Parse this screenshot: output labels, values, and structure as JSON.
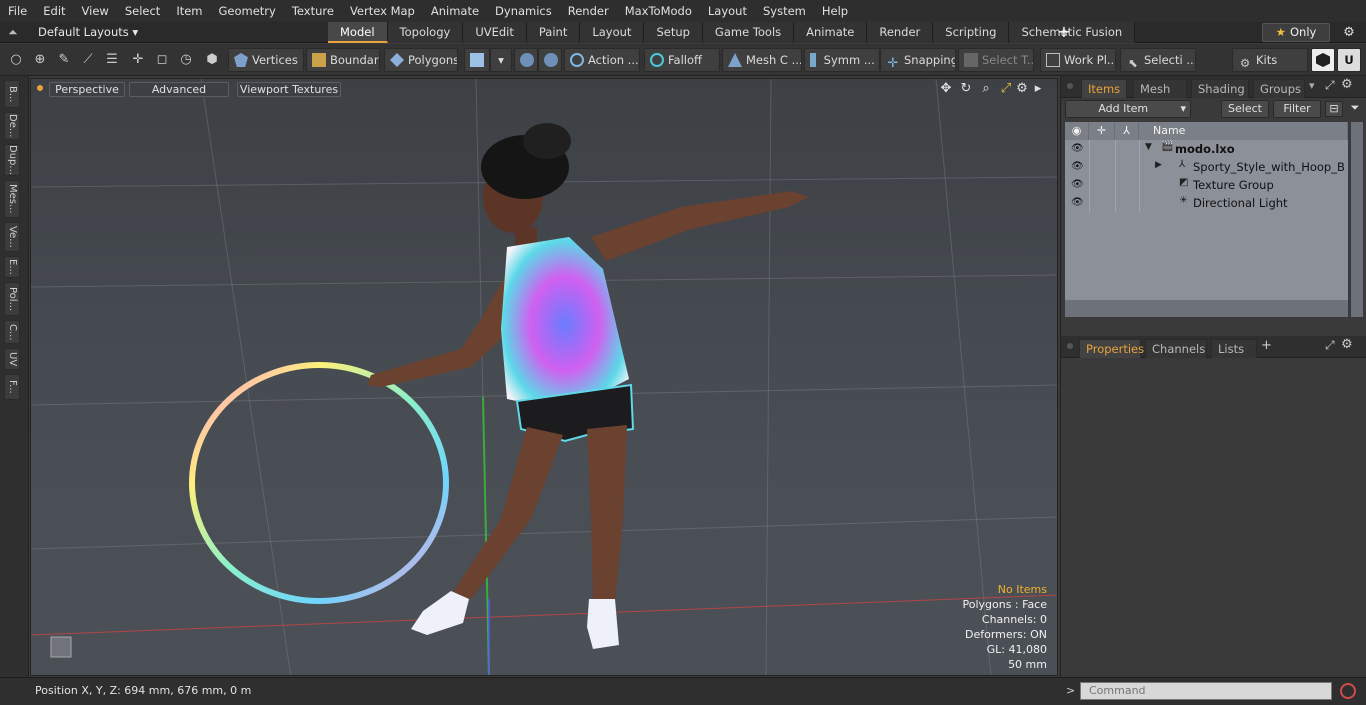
{
  "menubar": [
    "File",
    "Edit",
    "View",
    "Select",
    "Item",
    "Geometry",
    "Texture",
    "Vertex Map",
    "Animate",
    "Dynamics",
    "Render",
    "MaxToModo",
    "Layout",
    "System",
    "Help"
  ],
  "layout_selector": "Default Layouts",
  "tabs": [
    {
      "label": "Model",
      "active": true
    },
    {
      "label": "Topology"
    },
    {
      "label": "UVEdit"
    },
    {
      "label": "Paint"
    },
    {
      "label": "Layout"
    },
    {
      "label": "Setup"
    },
    {
      "label": "Game Tools"
    },
    {
      "label": "Animate"
    },
    {
      "label": "Render"
    },
    {
      "label": "Scripting"
    },
    {
      "label": "Schematic Fusion"
    }
  ],
  "tab_add": "+",
  "only_button": "Only",
  "toolbar": {
    "vertices": "Vertices",
    "boundary": "Boundary",
    "polygons": "Polygons",
    "action": "Action",
    "falloff": "Falloff",
    "mesh": "Mesh C ...",
    "symmetry": "Symm ...",
    "snapping": "Snapping",
    "select_t": "Select T...",
    "work_plane": "Work Pl...",
    "selection": "Selecti ...",
    "kits": "Kits"
  },
  "left_strip": [
    "B...",
    "De...",
    "Dup...",
    "Mes...",
    "Ve...",
    "E...",
    "Pol...",
    "C...",
    "UV",
    "F..."
  ],
  "viewport": {
    "view_mode": "Perspective",
    "advanced": "Advanced",
    "textures": "Viewport Textures",
    "info": [
      "No Items",
      "Polygons : Face",
      "Channels: 0",
      "Deformers: ON",
      "GL: 41,080",
      "50 mm"
    ]
  },
  "status": "Position X, Y, Z:  694 mm, 676 mm, 0 m",
  "items_panel": {
    "tabs": [
      "Items",
      "Mesh ...",
      "Shading",
      "Groups"
    ],
    "add_item": "Add Item",
    "select": "Select",
    "filter": "Filter",
    "name_header": "Name",
    "rows": [
      {
        "label": "modo.lxo",
        "bold": true
      },
      {
        "label": "Sporty_Style_with_Hoop_Bla ..."
      },
      {
        "label": "Texture Group"
      },
      {
        "label": "Directional Light"
      }
    ]
  },
  "properties_panel": {
    "tabs": [
      "Properties",
      "Channels",
      "Lists"
    ],
    "add": "+"
  },
  "command_placeholder": "Command"
}
